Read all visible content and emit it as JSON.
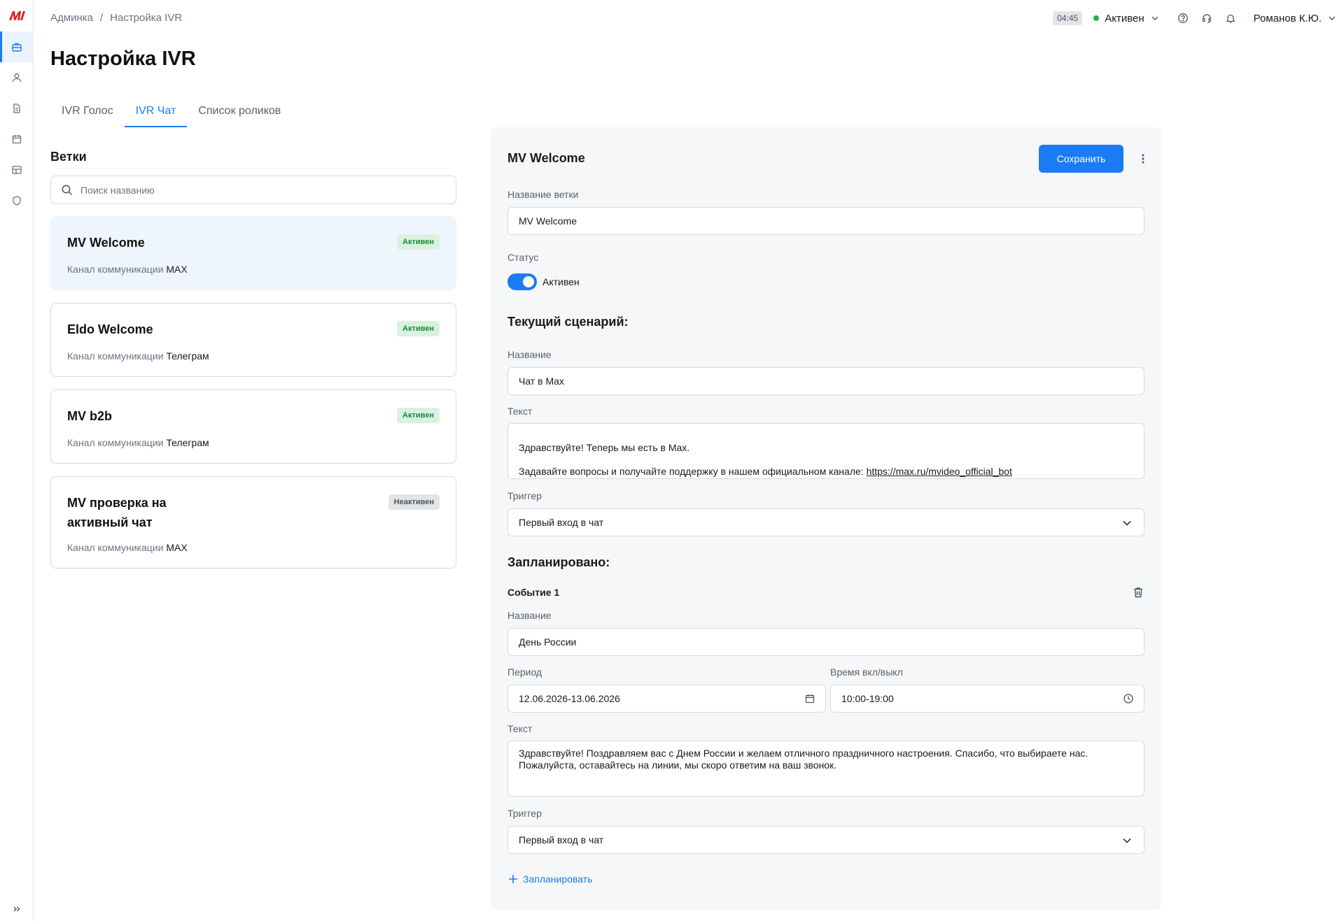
{
  "breadcrumb": {
    "root": "Админка",
    "separator": "/",
    "current": "Настройка IVR"
  },
  "topbar": {
    "timer": "04:45",
    "status_label": "Активен",
    "status_color": "#1fb14d",
    "user_name": "Романов К.Ю."
  },
  "sidebar": {
    "items": [
      {
        "icon": "briefcase-icon",
        "active": true
      },
      {
        "icon": "user-icon",
        "active": false
      },
      {
        "icon": "document-icon",
        "active": false
      },
      {
        "icon": "calendar-icon",
        "active": false
      },
      {
        "icon": "table-icon",
        "active": false
      },
      {
        "icon": "shield-icon",
        "active": false
      }
    ]
  },
  "page": {
    "title": "Настройка IVR"
  },
  "tabs": [
    {
      "label": "IVR Голос",
      "active": false
    },
    {
      "label": "IVR Чат",
      "active": true
    },
    {
      "label": "Список роликов",
      "active": false
    }
  ],
  "branches": {
    "title": "Ветки",
    "search_placeholder": "Поиск названию",
    "channel_label": "Канал коммуникации",
    "items": [
      {
        "name": "MV Welcome",
        "status": "Активен",
        "channel": "MAX"
      },
      {
        "name": "Eldo Welcome",
        "status": "Активен",
        "channel": "Телеграм"
      },
      {
        "name": "MV b2b",
        "status": "Активен",
        "channel": "Телеграм"
      },
      {
        "name": "MV проверка на\nактивный чат",
        "status": "Неактивен",
        "channel": "MAX"
      }
    ]
  },
  "editor": {
    "title": "MV Welcome",
    "save_label": "Сохранить",
    "branch_name_label": "Название ветки",
    "branch_name_value": "MV Welcome",
    "status_label": "Статус",
    "status_value": "Активен",
    "current_heading": "Текущий сценарий:",
    "current": {
      "name_label": "Название",
      "name_value": "Чат в Max",
      "text_label": "Текст",
      "text_line1": "Здравствуйте! Теперь мы есть в Max.",
      "text_line2_prefix": "Задавайте вопросы и получайте поддержку в нашем официальном канале: ",
      "text_link": "https://max.ru/mvideo_official_bot",
      "trigger_label": "Триггер",
      "trigger_value": "Первый вход в чат"
    },
    "scheduled_heading": "Запланировано:",
    "event": {
      "title": "Событие 1",
      "name_label": "Название",
      "name_value": "День России",
      "period_label": "Период",
      "period_value": "12.06.2026-13.06.2026",
      "time_label": "Время вкл/выкл",
      "time_value": "10:00-19:00",
      "text_label": "Текст",
      "text_value": "Здравствуйте! Поздравляем вас с Днем России и желаем отличного праздничного настроения. Спасибо, что выбираете нас.\nПожалуйста, оставайтесь на линии, мы скоро ответим на ваш звонок.",
      "trigger_label": "Триггер",
      "trigger_value": "Первый вход в чат"
    },
    "add_label": "Запланировать"
  },
  "colors": {
    "accent": "#1a7cf5",
    "active_badge_bg": "#d9f2df",
    "active_badge_text": "#1a8a3c",
    "selected_card_bg": "#eef5fd",
    "brand": "#e31e24"
  }
}
